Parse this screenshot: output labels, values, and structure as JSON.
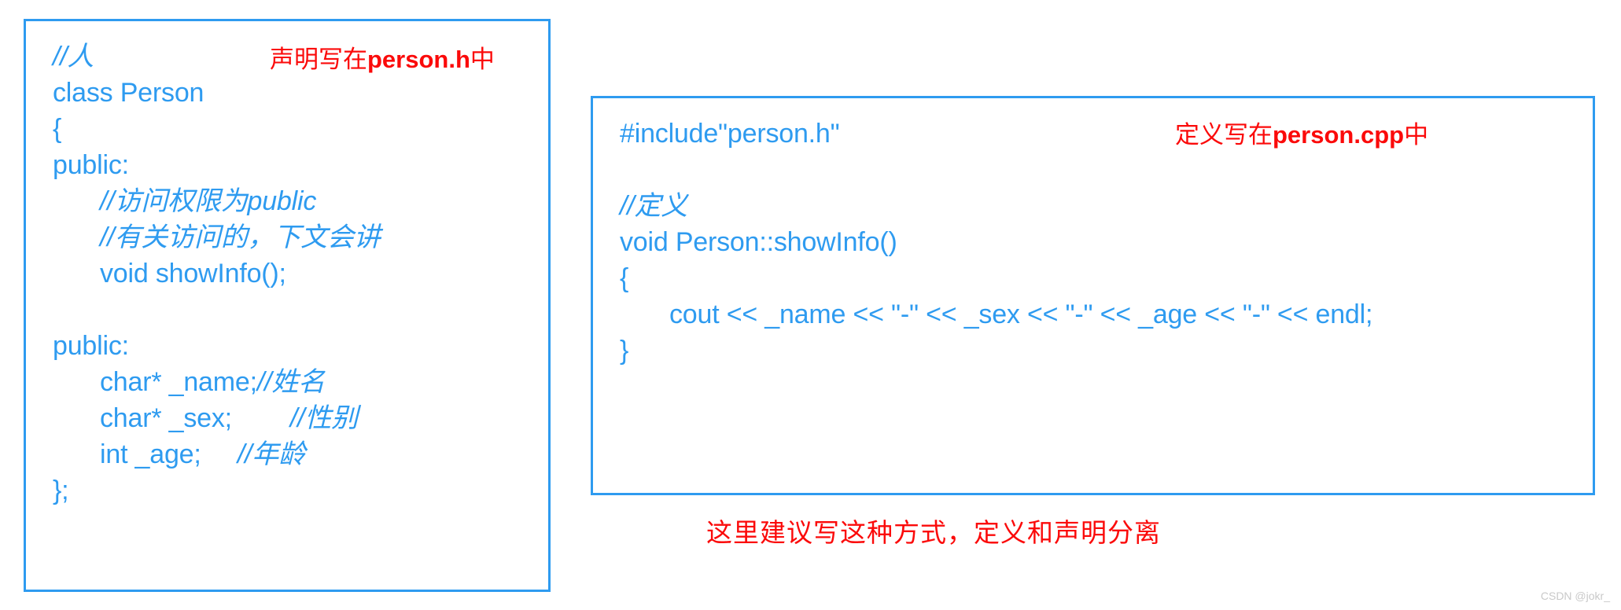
{
  "left_box": {
    "name": "person-h-declaration-box",
    "border_color": "#2e9bf0",
    "code_color": "#2e9bf0",
    "lines": [
      {
        "indent": 0,
        "code": "//人",
        "comment": true
      },
      {
        "indent": 0,
        "code": "class Person",
        "comment": false
      },
      {
        "indent": 0,
        "code": "{",
        "comment": false
      },
      {
        "indent": 0,
        "code": "public:",
        "comment": false
      },
      {
        "indent": 1,
        "code": "//访问权限为public",
        "comment": true
      },
      {
        "indent": 1,
        "code": "//有关访问的，下文会讲",
        "comment": true
      },
      {
        "indent": 1,
        "code": "void showInfo();",
        "comment": false
      },
      {
        "indent": 0,
        "code": "",
        "comment": false
      },
      {
        "indent": 0,
        "code": "public:",
        "comment": false
      },
      {
        "indent": 1,
        "code": "char* _name;",
        "trailing": "//姓名",
        "comment": false
      },
      {
        "indent": 1,
        "code": "char* _sex;        ",
        "trailing": "//性别",
        "comment": false
      },
      {
        "indent": 1,
        "code": "int _age;     ",
        "trailing": "//年龄",
        "comment": false
      },
      {
        "indent": 0,
        "code": "};",
        "comment": false
      }
    ]
  },
  "right_box": {
    "name": "person-cpp-definition-box",
    "border_color": "#2e9bf0",
    "code_color": "#2e9bf0",
    "lines": [
      {
        "indent": 0,
        "code": "#include\"person.h\"",
        "comment": false
      },
      {
        "indent": 0,
        "code": "",
        "comment": false
      },
      {
        "indent": 0,
        "code": "//定义",
        "comment": true
      },
      {
        "indent": 0,
        "code": "void Person::showInfo()",
        "comment": false
      },
      {
        "indent": 0,
        "code": "{",
        "comment": false
      },
      {
        "indent": 1,
        "code": "cout << _name << \"-\" << _sex << \"-\" << _age << \"-\" << endl;",
        "comment": false
      },
      {
        "indent": 0,
        "code": "}",
        "comment": false
      }
    ]
  },
  "annotations": {
    "color": "#fb0a0a",
    "header_declaration": {
      "cjk_prefix": "声明写在",
      "latin": "person.h",
      "cjk_suffix": "中"
    },
    "source_definition": {
      "cjk_prefix": "定义写在",
      "latin": "person.cpp",
      "cjk_suffix": "中"
    },
    "advice": "这里建议写这种方式，定义和声明分离"
  },
  "watermark": {
    "text": "CSDN @jokr_",
    "color": "#c9c9c9"
  }
}
